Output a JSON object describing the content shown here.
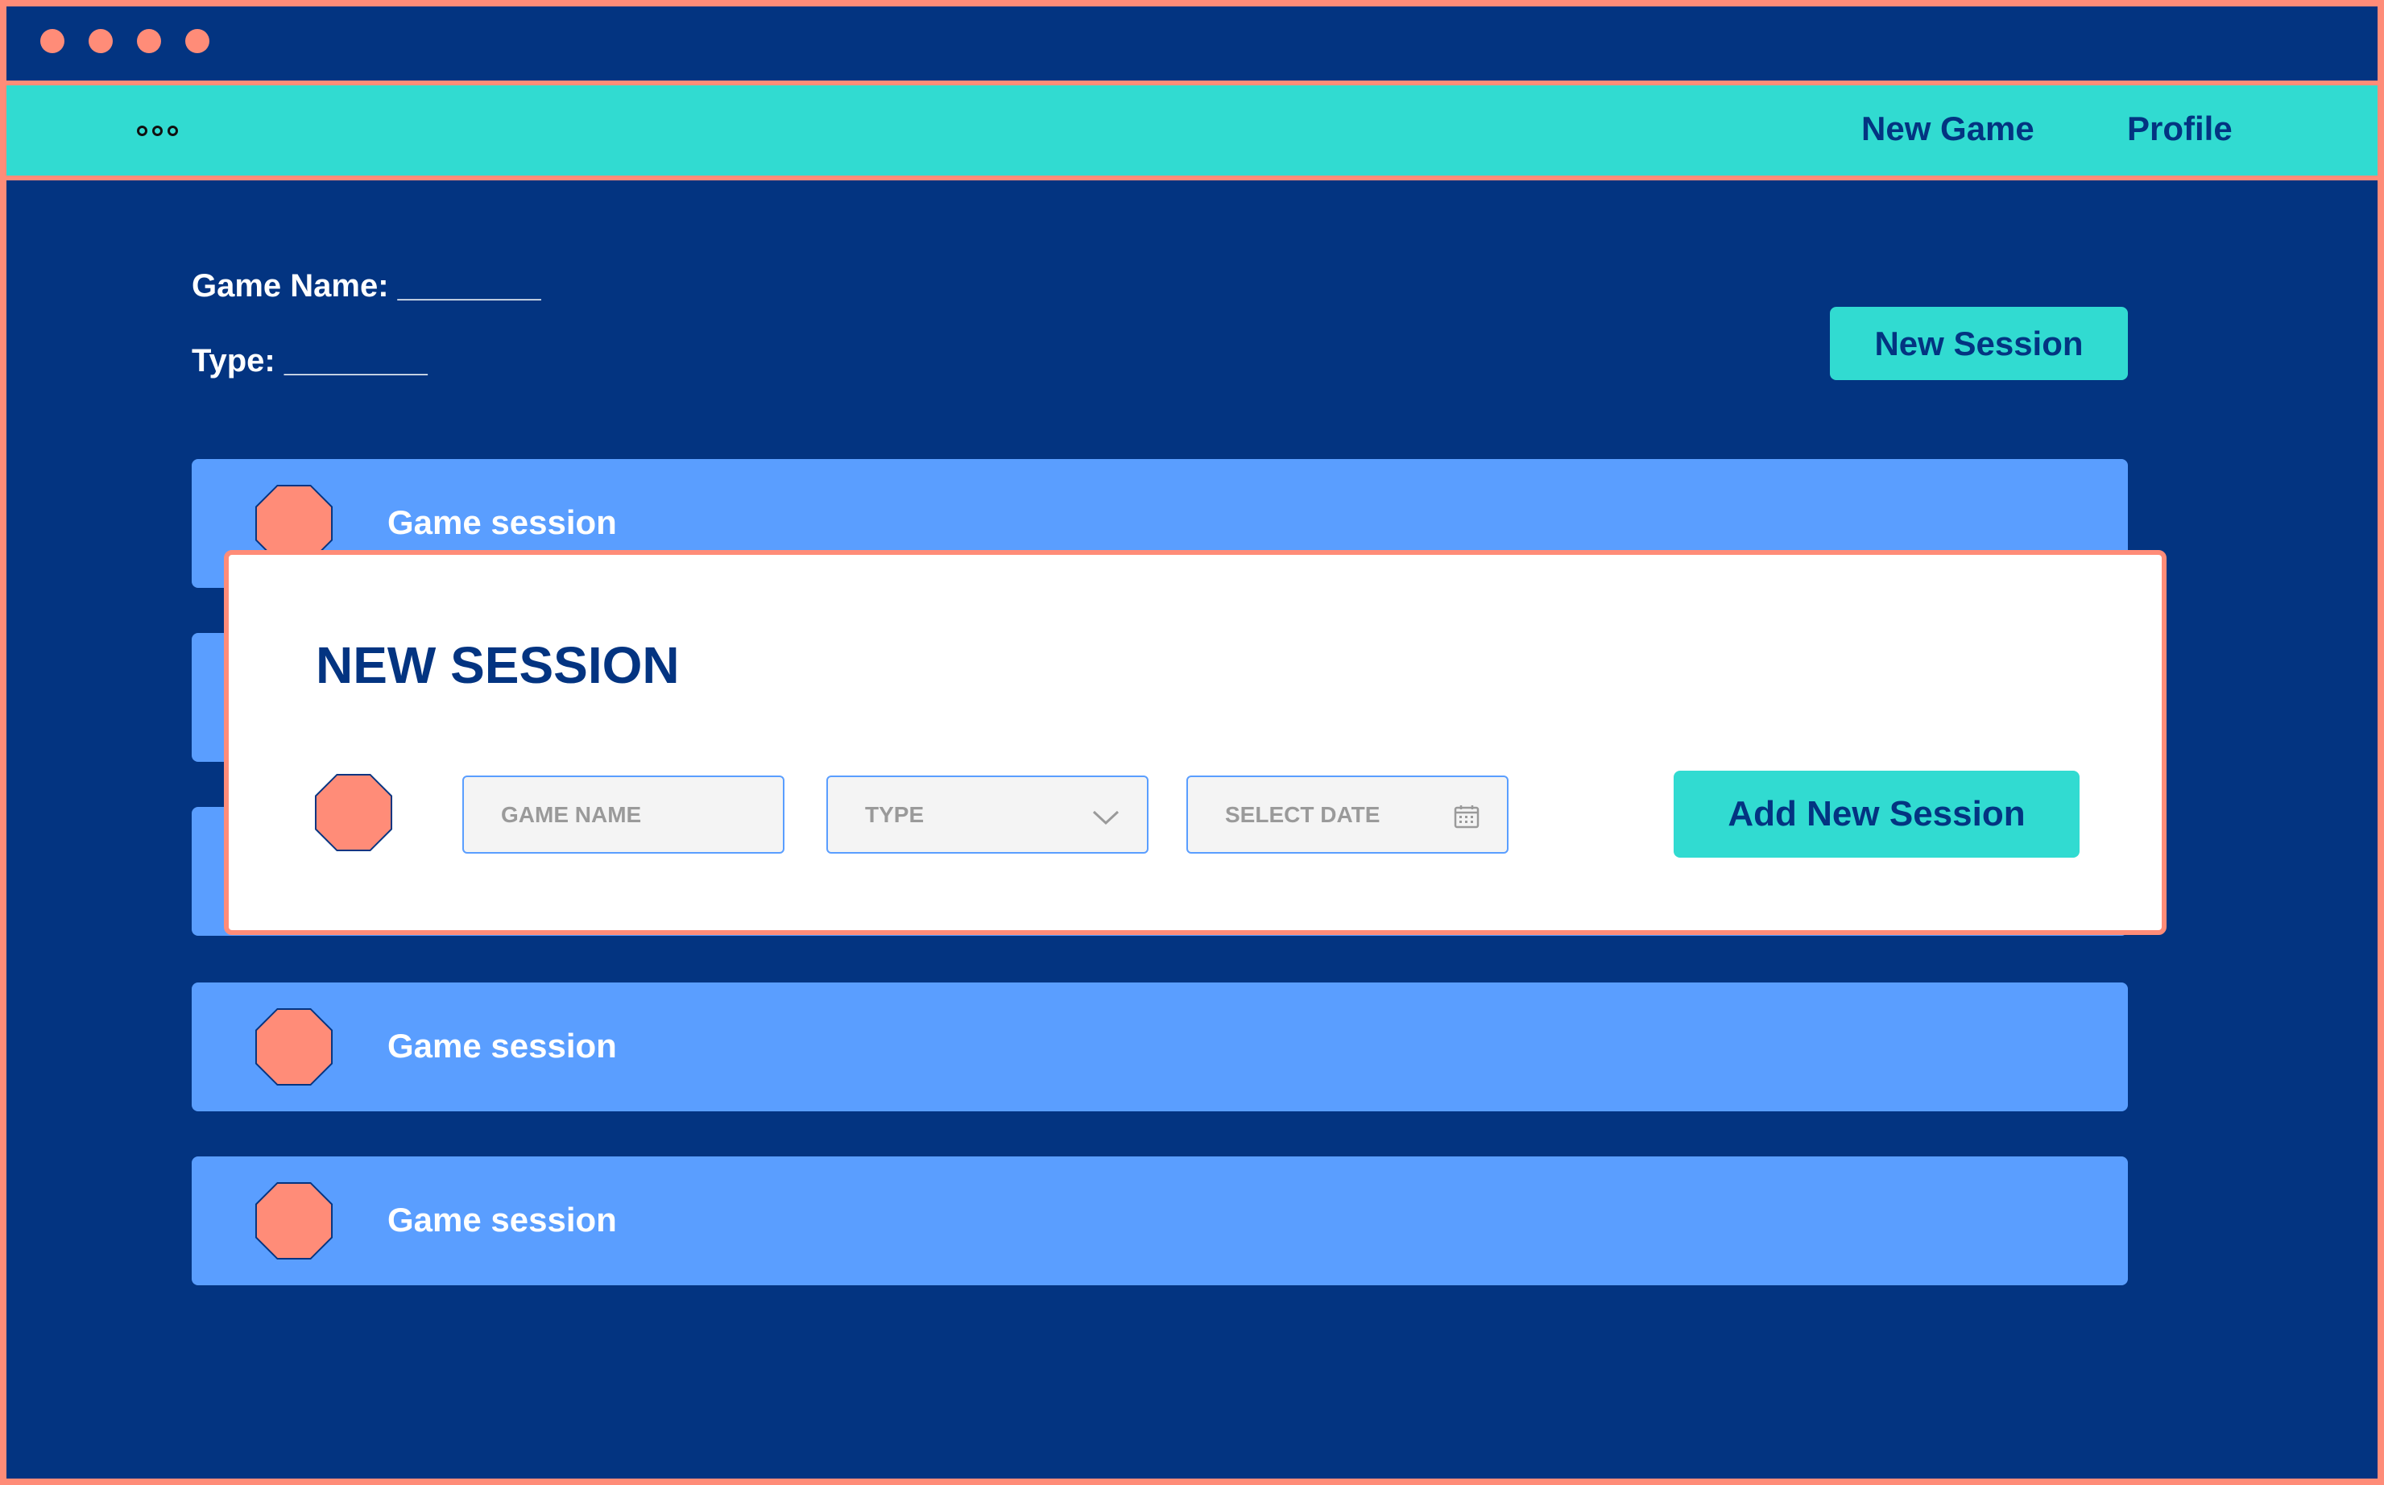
{
  "window": {
    "controls": [
      "dot",
      "dot",
      "dot",
      "dot"
    ]
  },
  "navbar": {
    "menu_icon": "more-icon",
    "links": [
      {
        "label": "New Game"
      },
      {
        "label": "Profile"
      }
    ]
  },
  "game_info": {
    "name_label": "Game Name: ________",
    "type_label": "Type: ________"
  },
  "actions": {
    "new_session_label": "New Session"
  },
  "sessions": [
    {
      "label": "Game session"
    },
    {
      "label": "Game session"
    },
    {
      "label": "Game session"
    }
  ],
  "modal": {
    "title": "NEW SESSION",
    "fields": {
      "game_name_placeholder": "GAME NAME",
      "type_placeholder": "TYPE",
      "date_placeholder": "SELECT DATE"
    },
    "submit_label": "Add New Session"
  },
  "colors": {
    "background": "#033481",
    "accent": "#31dbd1",
    "border": "#ff8c78",
    "row": "#5a9eff",
    "avatar": "#ff8c78"
  }
}
